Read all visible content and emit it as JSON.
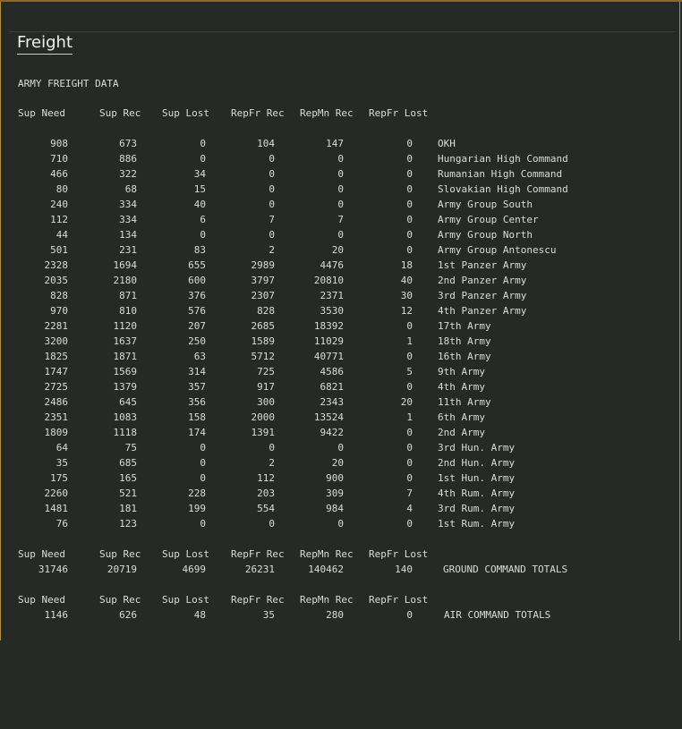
{
  "window": {
    "title": "Freight",
    "subtitle": "ARMY FREIGHT DATA"
  },
  "columns": [
    "Sup Need",
    "Sup Rec",
    "Sup Lost",
    "RepFr Rec",
    "RepMn Rec",
    "RepFr Lost"
  ],
  "rows": [
    {
      "sup_need": "908",
      "sup_rec": "673",
      "sup_lost": "0",
      "repfr_rec": "104",
      "repmn_rec": "147",
      "repfr_lost": "0",
      "name": "OKH"
    },
    {
      "sup_need": "710",
      "sup_rec": "886",
      "sup_lost": "0",
      "repfr_rec": "0",
      "repmn_rec": "0",
      "repfr_lost": "0",
      "name": "Hungarian High Command"
    },
    {
      "sup_need": "466",
      "sup_rec": "322",
      "sup_lost": "34",
      "repfr_rec": "0",
      "repmn_rec": "0",
      "repfr_lost": "0",
      "name": "Rumanian High Command"
    },
    {
      "sup_need": "80",
      "sup_rec": "68",
      "sup_lost": "15",
      "repfr_rec": "0",
      "repmn_rec": "0",
      "repfr_lost": "0",
      "name": "Slovakian High Command"
    },
    {
      "sup_need": "240",
      "sup_rec": "334",
      "sup_lost": "40",
      "repfr_rec": "0",
      "repmn_rec": "0",
      "repfr_lost": "0",
      "name": "Army Group South"
    },
    {
      "sup_need": "112",
      "sup_rec": "334",
      "sup_lost": "6",
      "repfr_rec": "7",
      "repmn_rec": "7",
      "repfr_lost": "0",
      "name": "Army Group Center"
    },
    {
      "sup_need": "44",
      "sup_rec": "134",
      "sup_lost": "0",
      "repfr_rec": "0",
      "repmn_rec": "0",
      "repfr_lost": "0",
      "name": "Army Group North"
    },
    {
      "sup_need": "501",
      "sup_rec": "231",
      "sup_lost": "83",
      "repfr_rec": "2",
      "repmn_rec": "20",
      "repfr_lost": "0",
      "name": "Army Group Antonescu"
    },
    {
      "sup_need": "2328",
      "sup_rec": "1694",
      "sup_lost": "655",
      "repfr_rec": "2989",
      "repmn_rec": "4476",
      "repfr_lost": "18",
      "name": "1st Panzer Army"
    },
    {
      "sup_need": "2035",
      "sup_rec": "2180",
      "sup_lost": "600",
      "repfr_rec": "3797",
      "repmn_rec": "20810",
      "repfr_lost": "40",
      "name": "2nd Panzer Army"
    },
    {
      "sup_need": "828",
      "sup_rec": "871",
      "sup_lost": "376",
      "repfr_rec": "2307",
      "repmn_rec": "2371",
      "repfr_lost": "30",
      "name": "3rd Panzer Army"
    },
    {
      "sup_need": "970",
      "sup_rec": "810",
      "sup_lost": "576",
      "repfr_rec": "828",
      "repmn_rec": "3530",
      "repfr_lost": "12",
      "name": "4th Panzer Army"
    },
    {
      "sup_need": "2281",
      "sup_rec": "1120",
      "sup_lost": "207",
      "repfr_rec": "2685",
      "repmn_rec": "18392",
      "repfr_lost": "0",
      "name": "17th Army"
    },
    {
      "sup_need": "3200",
      "sup_rec": "1637",
      "sup_lost": "250",
      "repfr_rec": "1589",
      "repmn_rec": "11029",
      "repfr_lost": "1",
      "name": "18th Army"
    },
    {
      "sup_need": "1825",
      "sup_rec": "1871",
      "sup_lost": "63",
      "repfr_rec": "5712",
      "repmn_rec": "40771",
      "repfr_lost": "0",
      "name": "16th Army"
    },
    {
      "sup_need": "1747",
      "sup_rec": "1569",
      "sup_lost": "314",
      "repfr_rec": "725",
      "repmn_rec": "4586",
      "repfr_lost": "5",
      "name": "9th Army"
    },
    {
      "sup_need": "2725",
      "sup_rec": "1379",
      "sup_lost": "357",
      "repfr_rec": "917",
      "repmn_rec": "6821",
      "repfr_lost": "0",
      "name": "4th Army"
    },
    {
      "sup_need": "2486",
      "sup_rec": "645",
      "sup_lost": "356",
      "repfr_rec": "300",
      "repmn_rec": "2343",
      "repfr_lost": "20",
      "name": "11th Army"
    },
    {
      "sup_need": "2351",
      "sup_rec": "1083",
      "sup_lost": "158",
      "repfr_rec": "2000",
      "repmn_rec": "13524",
      "repfr_lost": "1",
      "name": "6th Army"
    },
    {
      "sup_need": "1809",
      "sup_rec": "1118",
      "sup_lost": "174",
      "repfr_rec": "1391",
      "repmn_rec": "9422",
      "repfr_lost": "0",
      "name": "2nd Army"
    },
    {
      "sup_need": "64",
      "sup_rec": "75",
      "sup_lost": "0",
      "repfr_rec": "0",
      "repmn_rec": "0",
      "repfr_lost": "0",
      "name": "3rd Hun. Army"
    },
    {
      "sup_need": "35",
      "sup_rec": "685",
      "sup_lost": "0",
      "repfr_rec": "2",
      "repmn_rec": "20",
      "repfr_lost": "0",
      "name": "2nd Hun. Army"
    },
    {
      "sup_need": "175",
      "sup_rec": "165",
      "sup_lost": "0",
      "repfr_rec": "112",
      "repmn_rec": "900",
      "repfr_lost": "0",
      "name": "1st Hun. Army"
    },
    {
      "sup_need": "2260",
      "sup_rec": "521",
      "sup_lost": "228",
      "repfr_rec": "203",
      "repmn_rec": "309",
      "repfr_lost": "7",
      "name": "4th Rum. Army"
    },
    {
      "sup_need": "1481",
      "sup_rec": "181",
      "sup_lost": "199",
      "repfr_rec": "554",
      "repmn_rec": "984",
      "repfr_lost": "4",
      "name": "3rd Rum. Army"
    },
    {
      "sup_need": "76",
      "sup_rec": "123",
      "sup_lost": "0",
      "repfr_rec": "0",
      "repmn_rec": "0",
      "repfr_lost": "0",
      "name": "1st Rum. Army"
    }
  ],
  "ground_totals": {
    "sup_need": "31746",
    "sup_rec": "20719",
    "sup_lost": "4699",
    "repfr_rec": "26231",
    "repmn_rec": "140462",
    "repfr_lost": "140",
    "label": "GROUND COMMAND TOTALS"
  },
  "air_totals": {
    "sup_need": "1146",
    "sup_rec": "626",
    "sup_lost": "48",
    "repfr_rec": "35",
    "repmn_rec": "280",
    "repfr_lost": "0",
    "label": "AIR COMMAND TOTALS"
  }
}
